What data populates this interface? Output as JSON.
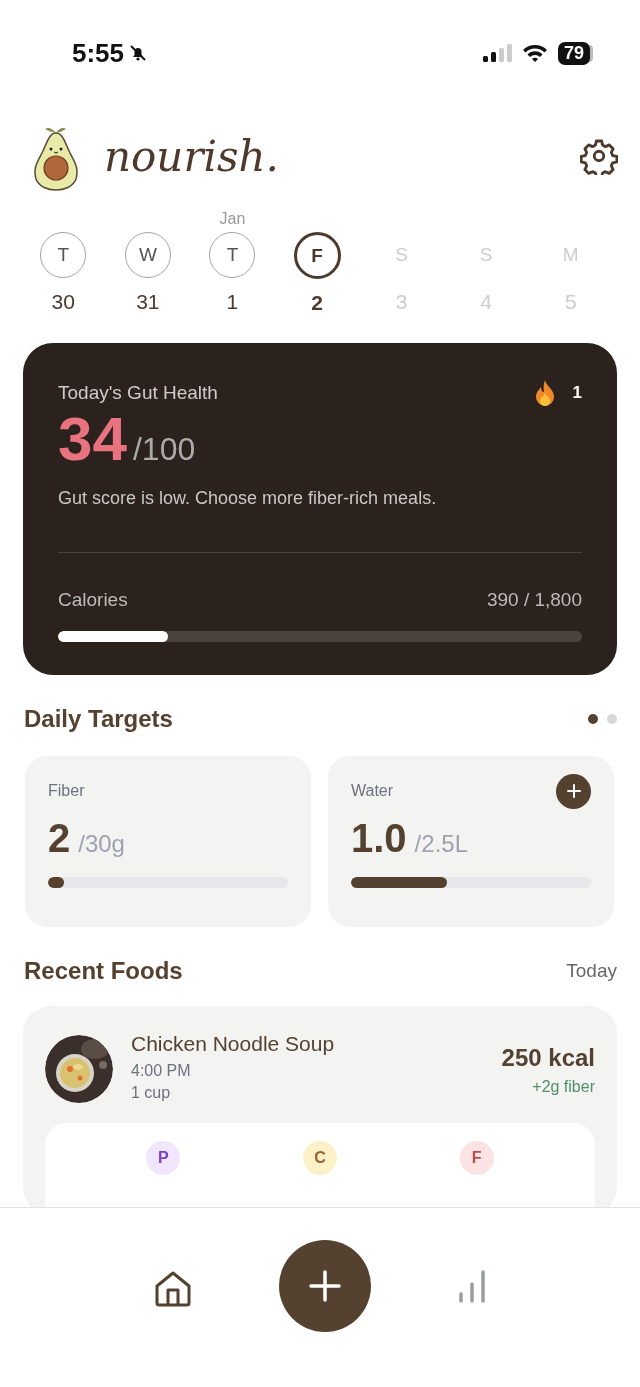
{
  "status_bar": {
    "time": "5:55",
    "battery": "79"
  },
  "header": {
    "logo": "nourish."
  },
  "days": [
    {
      "weekday": "T",
      "date": "30",
      "selected": false,
      "future": false
    },
    {
      "weekday": "W",
      "date": "31",
      "selected": false,
      "future": false
    },
    {
      "weekday": "T",
      "date": "1",
      "month": "Jan",
      "selected": false,
      "future": false
    },
    {
      "weekday": "F",
      "date": "2",
      "selected": true,
      "future": false
    },
    {
      "weekday": "S",
      "date": "3",
      "selected": false,
      "future": true
    },
    {
      "weekday": "S",
      "date": "4",
      "selected": false,
      "future": true
    },
    {
      "weekday": "M",
      "date": "5",
      "selected": false,
      "future": true
    }
  ],
  "gut_card": {
    "title": "Today's Gut Health",
    "score": "34",
    "max": "/100",
    "streak": "1",
    "message": "Gut score is low. Choose more fiber-rich meals.",
    "calories_label": "Calories",
    "calories_value": "390 / 1,800",
    "level": 0.21
  },
  "daily_targets": {
    "title": "Daily Targets",
    "pages": [
      {
        "selected": true
      },
      {
        "selected": false
      }
    ],
    "cards": [
      {
        "label": "Fiber",
        "value": "2",
        "goal": "/30g",
        "level": 0.04,
        "add_button": false
      },
      {
        "label": "Water",
        "value": "1.0",
        "goal": "/2.5L",
        "level": 0.4,
        "add_button": true
      }
    ]
  },
  "recent_foods": {
    "title": "Recent Foods",
    "filter": "Today",
    "items": [
      {
        "name": "Chicken Noodle Soup",
        "time": "4:00 PM",
        "portion": "1 cup",
        "kcal": "250 kcal",
        "fiber": "+2g fiber",
        "macros": [
          {
            "letter": "P",
            "color": "#f0e6fd"
          },
          {
            "letter": "C",
            "color": "#fdf1c9"
          },
          {
            "letter": "F",
            "color": "#fbe3e3"
          }
        ]
      }
    ]
  }
}
